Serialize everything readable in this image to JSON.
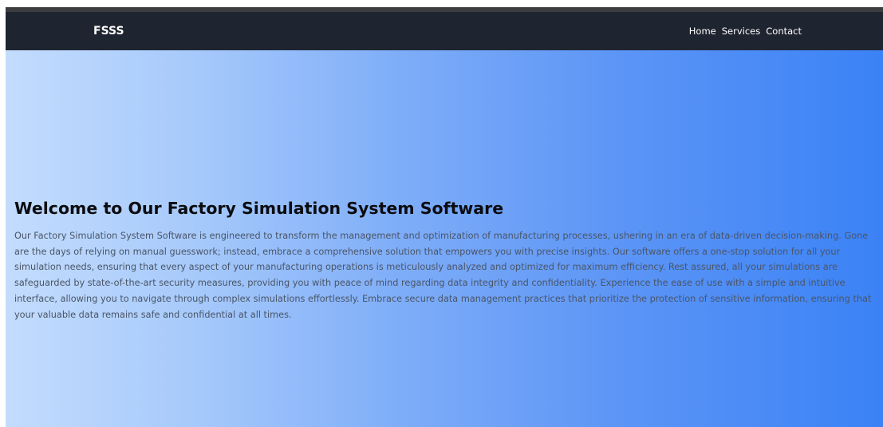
{
  "navbar": {
    "brand": "FSSS",
    "links": [
      "Home",
      "Services",
      "Contact"
    ]
  },
  "hero": {
    "title": "Welcome to Our Factory Simulation System Software",
    "description": "Our Factory Simulation System Software is engineered to transform the management and optimization of manufacturing processes, ushering in an era of data-driven decision-making. Gone are the days of relying on manual guesswork; instead, embrace a comprehensive solution that empowers you with precise insights. Our software offers a one-stop solution for all your simulation needs, ensuring that every aspect of your manufacturing operations is meticulously analyzed and optimized for maximum efficiency. Rest assured, all your simulations are safeguarded by state-of-the-art security measures, providing you with peace of mind regarding data integrity and confidentiality. Experience the ease of use with a simple and intuitive interface, allowing you to navigate through complex simulations effortlessly. Embrace secure data management practices that prioritize the protection of sensitive information, ensuring that your valuable data remains safe and confidential at all times."
  },
  "colors": {
    "navbar_bg": "#1f2530",
    "hero_gradient_start": "#c3dcfd",
    "hero_gradient_end": "#3b82f6",
    "title_color": "#0b0c10",
    "text_color": "#4a5566"
  }
}
